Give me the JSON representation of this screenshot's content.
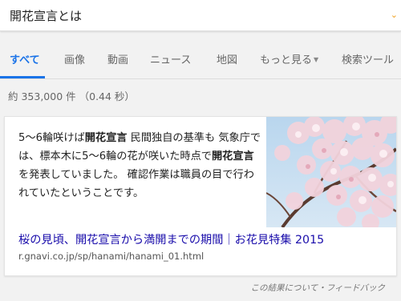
{
  "search": {
    "query": "開花宣言とは"
  },
  "tabs": [
    {
      "label": "すべて"
    },
    {
      "label": "画像"
    },
    {
      "label": "動画"
    },
    {
      "label": "ニュース"
    },
    {
      "label": "地図"
    },
    {
      "label": "もっと見る"
    },
    {
      "label": "検索ツール"
    }
  ],
  "result_stats": "約 353,000 件 （0.44 秒）",
  "featured_snippet": {
    "text": [
      {
        "t": "5〜6輪咲けば",
        "b": false
      },
      {
        "t": "開花宣言",
        "b": true
      },
      {
        "t": " 民間独自の基準も 気象庁では、標本木に5〜6輪の花が咲いた時点で",
        "b": false
      },
      {
        "t": "開花宣言",
        "b": true
      },
      {
        "t": "を発表していました。 確認作業は職員の目で行われていたということです。",
        "b": false
      }
    ],
    "title": "桜の見頃、開花宣言から満開までの期間｜お花見特集 2015",
    "url": "r.gnavi.co.jp/sp/hanami/hanami_01.html",
    "image_icon": "cherry-blossom-photo"
  },
  "feedback": "この結果について・フィードバック",
  "colors": {
    "accent": "#1a73e8",
    "link": "#1a0dab",
    "background": "#f2f2f2"
  }
}
